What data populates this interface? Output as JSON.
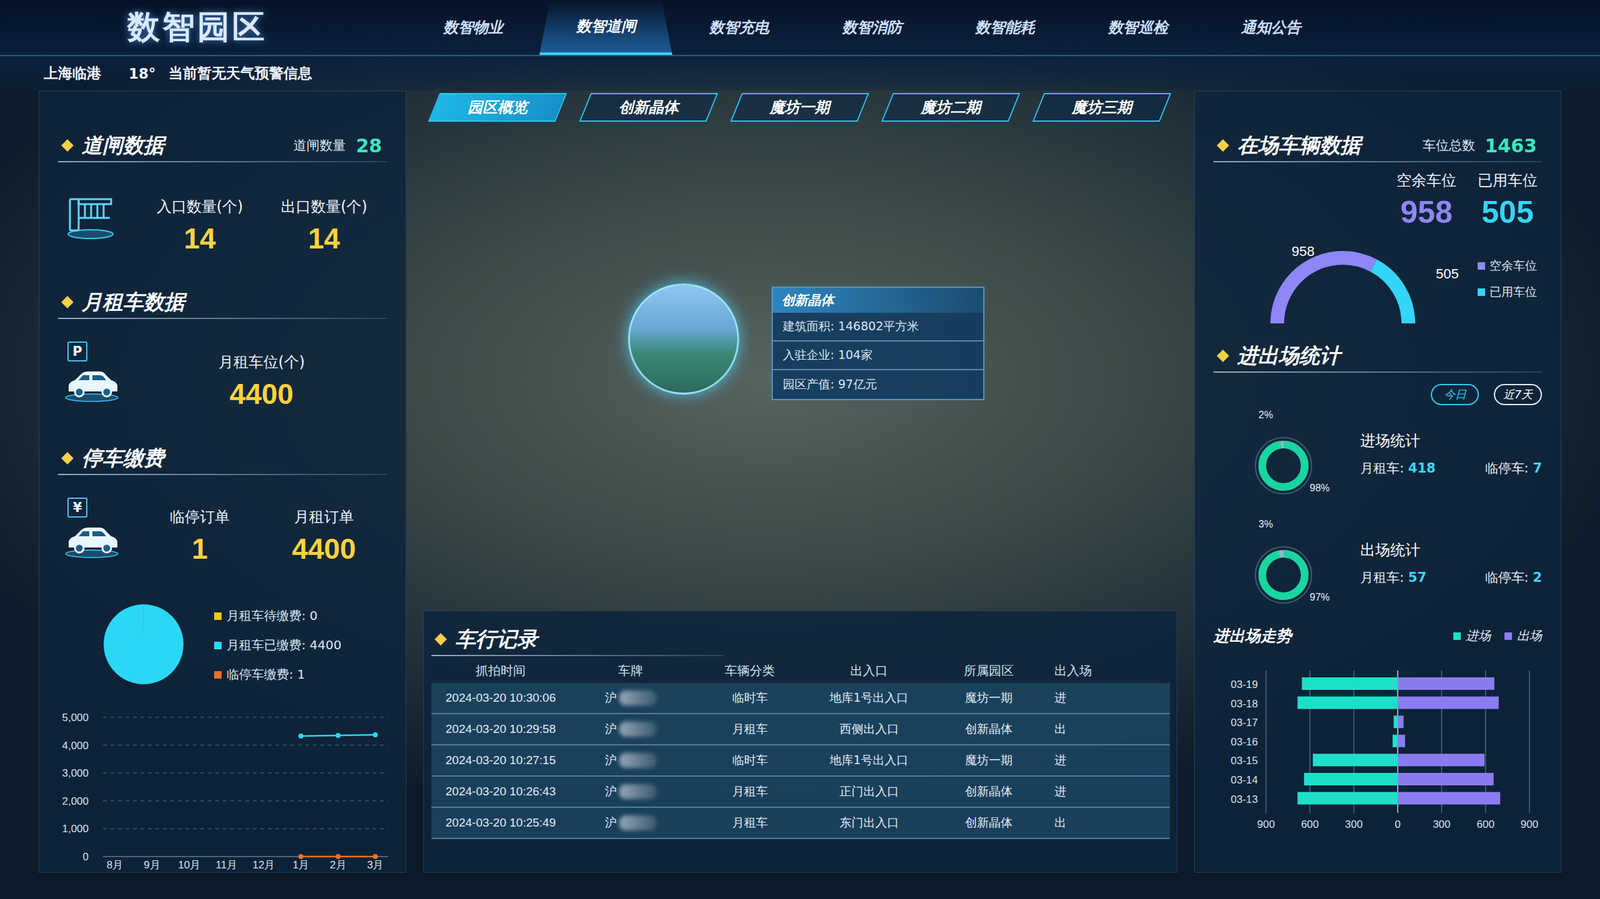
{
  "header": {
    "logo": "数智园区",
    "location": "上海临港",
    "temperature": "18°",
    "weather": "当前暂无天气预警信息"
  },
  "nav": [
    {
      "label": "数智物业",
      "selected": false
    },
    {
      "label": "数智道闸",
      "selected": true
    },
    {
      "label": "数智充电",
      "selected": false
    },
    {
      "label": "数智消防",
      "selected": false
    },
    {
      "label": "数智能耗",
      "selected": false
    },
    {
      "label": "数智巡检",
      "selected": false
    },
    {
      "label": "通知公告",
      "selected": false
    }
  ],
  "subTabs": [
    {
      "label": "园区概览",
      "selected": true
    },
    {
      "label": "创新晶体",
      "selected": false
    },
    {
      "label": "魔坊一期",
      "selected": false
    },
    {
      "label": "魔坊二期",
      "selected": false
    },
    {
      "label": "魔坊三期",
      "selected": false
    }
  ],
  "gate": {
    "title": "道闸数据",
    "countLabel": "道闸数量",
    "count": "28",
    "stats": [
      {
        "label": "入口数量(个)",
        "value": "14"
      },
      {
        "label": "出口数量(个)",
        "value": "14"
      }
    ]
  },
  "monthly": {
    "title": "月租车数据",
    "badge": "P",
    "stats": [
      {
        "label": "月租车位(个)",
        "value": "4400"
      }
    ]
  },
  "payment": {
    "title": "停车缴费",
    "badge": "¥",
    "stats": [
      {
        "label": "临停订单",
        "value": "1"
      },
      {
        "label": "月租订单",
        "value": "4400"
      }
    ],
    "pie": [
      {
        "label": "月租车待缴费: 0",
        "value": 0,
        "color": "#f5c518"
      },
      {
        "label": "月租车已缴费: 4400",
        "value": 4400,
        "color": "#2ad8f5"
      },
      {
        "label": "临停车缴费: 1",
        "value": 1,
        "color": "#e8702a"
      }
    ],
    "chart": {
      "yTicks": [
        "5,000",
        "4,000",
        "3,000",
        "2,000",
        "1,000",
        "0"
      ],
      "xLabels": [
        "8月",
        "9月",
        "10月",
        "11月",
        "12月",
        "1月",
        "2月",
        "3月"
      ],
      "series": [
        {
          "color": "#2ad8f5",
          "values": [
            null,
            null,
            null,
            null,
            null,
            4330,
            4350,
            4370
          ]
        },
        {
          "color": "#e8702a",
          "values": [
            null,
            null,
            null,
            null,
            null,
            1,
            0,
            1
          ]
        }
      ]
    }
  },
  "building": {
    "title": "创新晶体",
    "rows": [
      "建筑面积: 146802平方米",
      "入驻企业: 104家",
      "园区产值: 97亿元"
    ]
  },
  "records": {
    "title": "车行记录",
    "columns": [
      "抓拍时间",
      "车牌",
      "车辆分类",
      "出入口",
      "所属园区",
      "出入场"
    ],
    "rows": [
      [
        "2024-03-20 10:30:06",
        "沪",
        "临时车",
        "地库1号出入口",
        "魔坊一期",
        "进"
      ],
      [
        "2024-03-20 10:29:58",
        "沪",
        "月租车",
        "西侧出入口",
        "创新晶体",
        "出"
      ],
      [
        "2024-03-20 10:27:15",
        "沪",
        "临时车",
        "地库1号出入口",
        "魔坊一期",
        "进"
      ],
      [
        "2024-03-20 10:26:43",
        "沪",
        "月租车",
        "正门出入口",
        "创新晶体",
        "进"
      ],
      [
        "2024-03-20 10:25:49",
        "沪",
        "月租车",
        "东门出入口",
        "创新晶体",
        "出"
      ]
    ]
  },
  "parking": {
    "title": "在场车辆数据",
    "totalLabel": "车位总数",
    "total": "1463",
    "stats": [
      {
        "label": "空余车位",
        "value": "958",
        "amount": 958,
        "color": "#8f86f7"
      },
      {
        "label": "已用车位",
        "value": "505",
        "amount": 505,
        "color": "#35d5f7"
      }
    ]
  },
  "flow": {
    "title": "进出场统计",
    "ranges": [
      {
        "label": "今日",
        "selected": true
      },
      {
        "label": "近7天",
        "selected": false
      }
    ],
    "items": [
      {
        "title": "进场统计",
        "percent": "98%",
        "rest": "2%",
        "level": 0.98,
        "monthlyLabel": "月租车:",
        "monthly": "418",
        "tempLabel": "临停车:",
        "temp": "7"
      },
      {
        "title": "出场统计",
        "percent": "97%",
        "rest": "3%",
        "level": 0.97,
        "monthlyLabel": "月租车:",
        "monthly": "57",
        "tempLabel": "临停车:",
        "temp": "2"
      }
    ]
  },
  "trend": {
    "title": "进出场走势",
    "dates": [
      "03-19",
      "03-18",
      "03-17",
      "03-16",
      "03-15",
      "03-14",
      "03-13"
    ],
    "ticks": [
      "900",
      "600",
      "300",
      "0",
      "300",
      "600",
      "900"
    ],
    "series": [
      {
        "name": "进场",
        "color": "#1ee0c8",
        "values": [
          655,
          685,
          28,
          35,
          580,
          640,
          685
        ]
      },
      {
        "name": "出场",
        "color": "#8a7cf0",
        "values": [
          660,
          690,
          40,
          50,
          593,
          655,
          700
        ]
      }
    ]
  }
}
